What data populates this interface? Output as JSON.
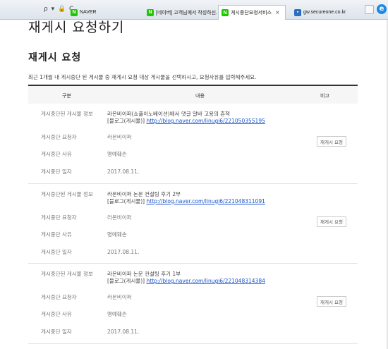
{
  "browser": {
    "address_tools": "ρ ▾ 🔒 C",
    "tabs": [
      {
        "icon": "naver",
        "label": "NAVER"
      },
      {
        "icon": "naver",
        "label": "[네이버] 고객님께서 작성하신..."
      },
      {
        "icon": "naver",
        "label": "게시중단요청서비스"
      },
      {
        "icon": "secureone",
        "label": "gw.secureone.co.kr"
      }
    ],
    "close_glyph": "×",
    "ie_glyph": "e"
  },
  "page": {
    "big_title": "재게시 요청하기",
    "section_title": "재게시 요청",
    "description": "최근 1개월 내 게시중단 된 게시물 중 재게시 요청 대상 게시물을 선택하시고, 요청사유를 입력해주세요.",
    "table_headers": {
      "category": "구분",
      "content": "내용",
      "note": "비고"
    },
    "row_labels": {
      "post": "게시중단된 게시물 정보",
      "requester": "게시중단 요청자",
      "reason": "게시중단 사유",
      "date": "게시중단 일자"
    },
    "request_button": "재게시 요청",
    "entries": [
      {
        "title": "라온비이퍼(쇼플이노베이션)에서 댓글 알바 고용의 흔적",
        "link_prefix": "[블로그(게시물)]",
        "link": "http://blog.naver.com/linugi6/221050355195",
        "requester": "라온비이퍼",
        "reason": "명예훼손",
        "date": "2017.08.11."
      },
      {
        "title": "라온비이퍼 논문 컨설팅 후기 2부",
        "link_prefix": "[블로그(게시물)]",
        "link": "http://blog.naver.com/linugi6/221048311091",
        "requester": "라온비이퍼",
        "reason": "명예훼손",
        "date": "2017.08.11."
      },
      {
        "title": "라온비이퍼 논문 컨설팅 후기 1부",
        "link_prefix": "[블로그(게시물)]",
        "link": "http://blog.naver.com/linugi6/221048314384",
        "requester": "라온비이퍼",
        "reason": "명예훼손",
        "date": "2017.08.11."
      }
    ]
  },
  "colors": {
    "link": "#1a54cc",
    "naver_green": "#1ec800",
    "header_border": "#333333"
  }
}
